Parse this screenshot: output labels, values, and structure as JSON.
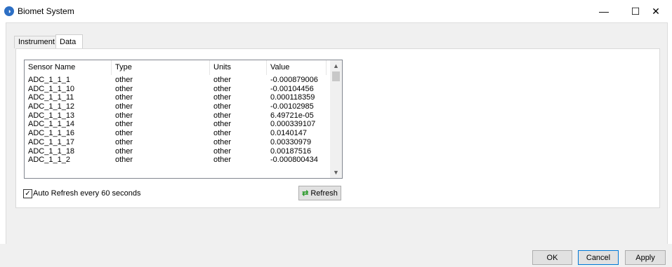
{
  "window": {
    "title": "Biomet System",
    "icon": "app-logo-icon"
  },
  "tabs": [
    {
      "label": "Instrument"
    },
    {
      "label": "Data"
    }
  ],
  "table": {
    "columns": [
      "Sensor Name",
      "Type",
      "Units",
      "Value"
    ],
    "rows": [
      [
        "ADC_1_1_1",
        "other",
        "other",
        "-0.000879006"
      ],
      [
        "ADC_1_1_10",
        "other",
        "other",
        "-0.00104456"
      ],
      [
        "ADC_1_1_11",
        "other",
        "other",
        "0.000118359"
      ],
      [
        "ADC_1_1_12",
        "other",
        "other",
        "-0.00102985"
      ],
      [
        "ADC_1_1_13",
        "other",
        "other",
        "6.49721e-05"
      ],
      [
        "ADC_1_1_14",
        "other",
        "other",
        "0.000339107"
      ],
      [
        "ADC_1_1_16",
        "other",
        "other",
        "0.0140147"
      ],
      [
        "ADC_1_1_17",
        "other",
        "other",
        "0.00330979"
      ],
      [
        "ADC_1_1_18",
        "other",
        "other",
        "0.00187516"
      ],
      [
        "ADC_1_1_2",
        "other",
        "other",
        "-0.000800434"
      ]
    ]
  },
  "auto_refresh": {
    "label": "Auto Refresh every 60 seconds",
    "checked": true
  },
  "buttons": {
    "refresh": "Refresh",
    "ok": "OK",
    "cancel": "Cancel",
    "apply": "Apply"
  },
  "colors": {
    "accent": "#0078d7",
    "refresh_icon": "#2a9a2a"
  }
}
